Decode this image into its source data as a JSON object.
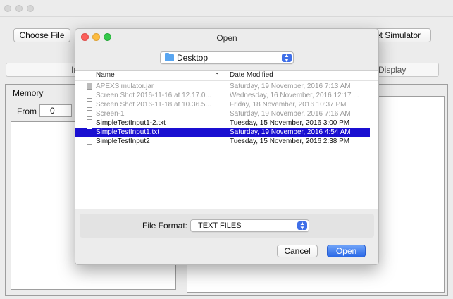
{
  "app": {
    "choose_file_label": "Choose File",
    "reset_label": "Reset Simulator",
    "left_button_fragment": "In",
    "display_label": "Display",
    "memory_label": "Memory",
    "from_label": "From",
    "from_value": "0"
  },
  "dialog": {
    "title": "Open",
    "location": "Desktop",
    "columns": {
      "name": "Name",
      "date": "Date Modified"
    },
    "files": [
      {
        "name": "APEXSimulator.jar",
        "date": "Saturday, 19 November, 2016 7:13 AM",
        "state": "disabled"
      },
      {
        "name": "Screen Shot 2016-11-16 at 12.17.0...",
        "date": "Wednesday, 16 November, 2016 12:17 ...",
        "state": "disabled"
      },
      {
        "name": "Screen Shot 2016-11-18 at 10.36.5...",
        "date": "Friday, 18 November, 2016 10:37 PM",
        "state": "disabled"
      },
      {
        "name": "Screen-1",
        "date": "Saturday, 19 November, 2016 7:16 AM",
        "state": "disabled"
      },
      {
        "name": "SimpleTestInput1-2.txt",
        "date": "Tuesday, 15 November, 2016 3:00 PM",
        "state": "enabled"
      },
      {
        "name": "SimpleTestInput1.txt",
        "date": "Saturday, 19 November, 2016 4:54 AM",
        "state": "selected"
      },
      {
        "name": "SimpleTestInput2",
        "date": "Tuesday, 15 November, 2016 2:38 PM",
        "state": "enabled"
      }
    ],
    "format_label": "File Format:",
    "format_value": "TEXT FILES",
    "cancel_label": "Cancel",
    "open_label": "Open"
  },
  "colors": {
    "selection": "#1a0fd1",
    "accent": "#2a68e6",
    "close": "#fc605b",
    "minimize": "#fdbc40",
    "zoom": "#34c84a"
  }
}
